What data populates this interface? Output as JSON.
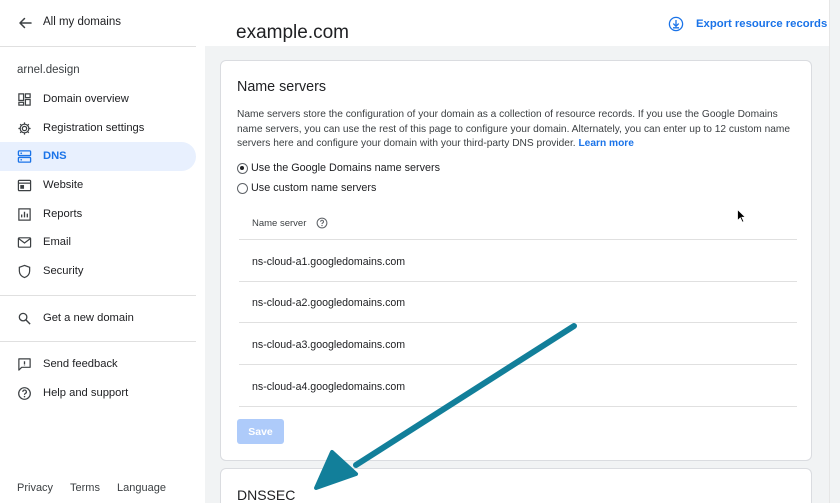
{
  "sidebar": {
    "back_label": "All my domains",
    "domain": "arnel.design",
    "nav": [
      {
        "label": "Domain overview",
        "icon": "dashboard-icon",
        "active": false
      },
      {
        "label": "Registration settings",
        "icon": "gear-icon",
        "active": false
      },
      {
        "label": "DNS",
        "icon": "dns-icon",
        "active": true
      },
      {
        "label": "Website",
        "icon": "website-icon",
        "active": false
      },
      {
        "label": "Reports",
        "icon": "reports-icon",
        "active": false
      },
      {
        "label": "Email",
        "icon": "email-icon",
        "active": false
      },
      {
        "label": "Security",
        "icon": "shield-icon",
        "active": false
      }
    ],
    "get_domain": {
      "label": "Get a new domain",
      "icon": "search-icon"
    },
    "feedback": {
      "label": "Send feedback",
      "icon": "feedback-icon"
    },
    "help": {
      "label": "Help and support",
      "icon": "help-icon"
    },
    "footer": {
      "privacy": "Privacy",
      "terms": "Terms",
      "language": "Language"
    }
  },
  "header": {
    "title": "example.com",
    "export_label": "Export resource records"
  },
  "name_servers": {
    "title": "Name servers",
    "description": "Name servers store the configuration of your domain as a collection of resource records. If you use the Google Domains name servers, you can use the rest of this page to configure your domain. Alternately, you can enter up to 12 custom name servers here and configure your domain with your third-party DNS provider.",
    "learn_more": "Learn more",
    "option_google": "Use the Google Domains name servers",
    "option_custom": "Use custom name servers",
    "selected_option": "google",
    "column_header": "Name server",
    "servers": [
      "ns-cloud-a1.googledomains.com",
      "ns-cloud-a2.googledomains.com",
      "ns-cloud-a3.googledomains.com",
      "ns-cloud-a4.googledomains.com"
    ],
    "save_label": "Save"
  },
  "dnssec": {
    "title": "DNSSEC"
  },
  "colors": {
    "accent": "#1a73e8",
    "active_bg": "#e8f0fe",
    "page_bg": "#f1f3f4",
    "annotation_arrow": "#127f9a",
    "save_disabled": "#aecbfa"
  }
}
